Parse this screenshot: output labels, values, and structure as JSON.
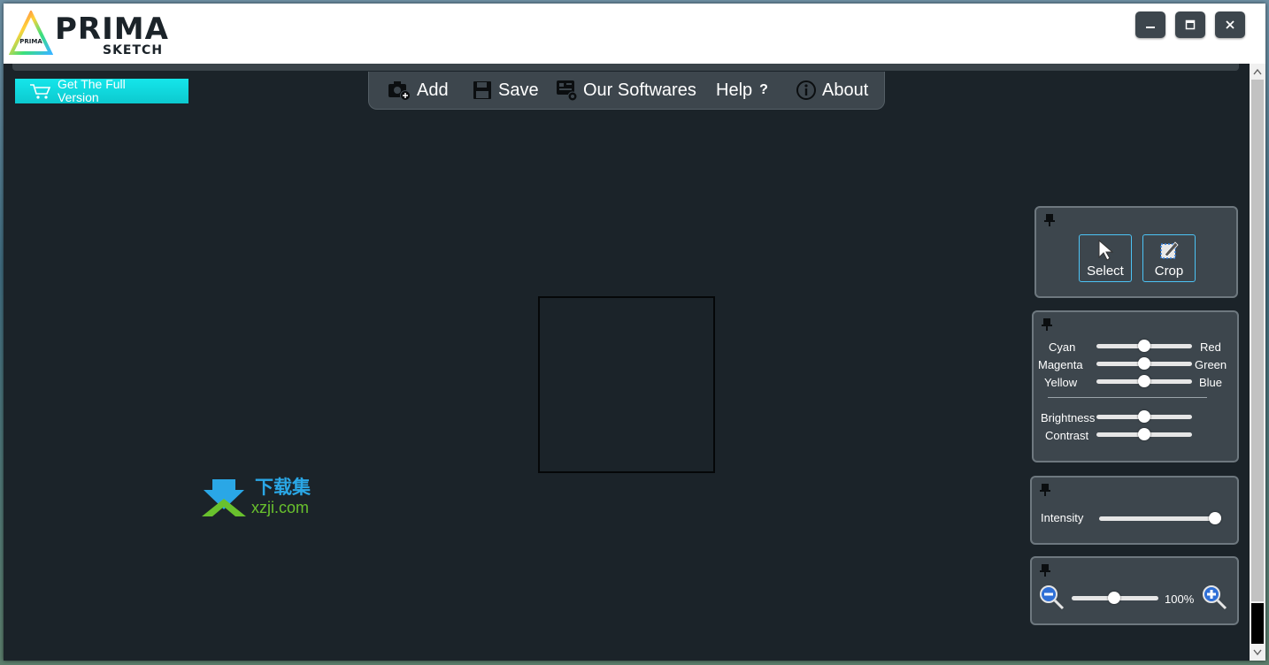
{
  "app": {
    "logo_line1": "PRIMA",
    "logo_line2": "SKETCH",
    "logo_badge": "PRIMA"
  },
  "window_controls": {
    "minimize": "🗕",
    "maximize": "🗖",
    "close": "✕"
  },
  "promo": {
    "label": "Get The Full Version"
  },
  "menu": {
    "add": "Add",
    "save": "Save",
    "softwares": "Our Softwares",
    "help": "Help",
    "help_mark": "?",
    "about": "About"
  },
  "tools_panel": {
    "select_label": "Select",
    "crop_label": "Crop"
  },
  "color_panel": {
    "rows": [
      {
        "left": "Cyan",
        "right": "Red",
        "level": 0.5
      },
      {
        "left": "Magenta",
        "right": "Green",
        "level": 0.5
      },
      {
        "left": "Yellow",
        "right": "Blue",
        "level": 0.5
      }
    ],
    "brightness_label": "Brightness",
    "brightness_level": 0.5,
    "contrast_label": "Contrast",
    "contrast_level": 0.5
  },
  "intensity_panel": {
    "label": "Intensity",
    "level": 1.0
  },
  "zoom_panel": {
    "value": "100%",
    "level": 0.5
  },
  "watermark": {
    "chinese": "下载集",
    "url": "xzji.com"
  },
  "colors": {
    "background": "#1b2329",
    "panel": "#3d464d",
    "accent_cyan": "#0cc9cf",
    "tool_border": "#4cc3f5"
  }
}
